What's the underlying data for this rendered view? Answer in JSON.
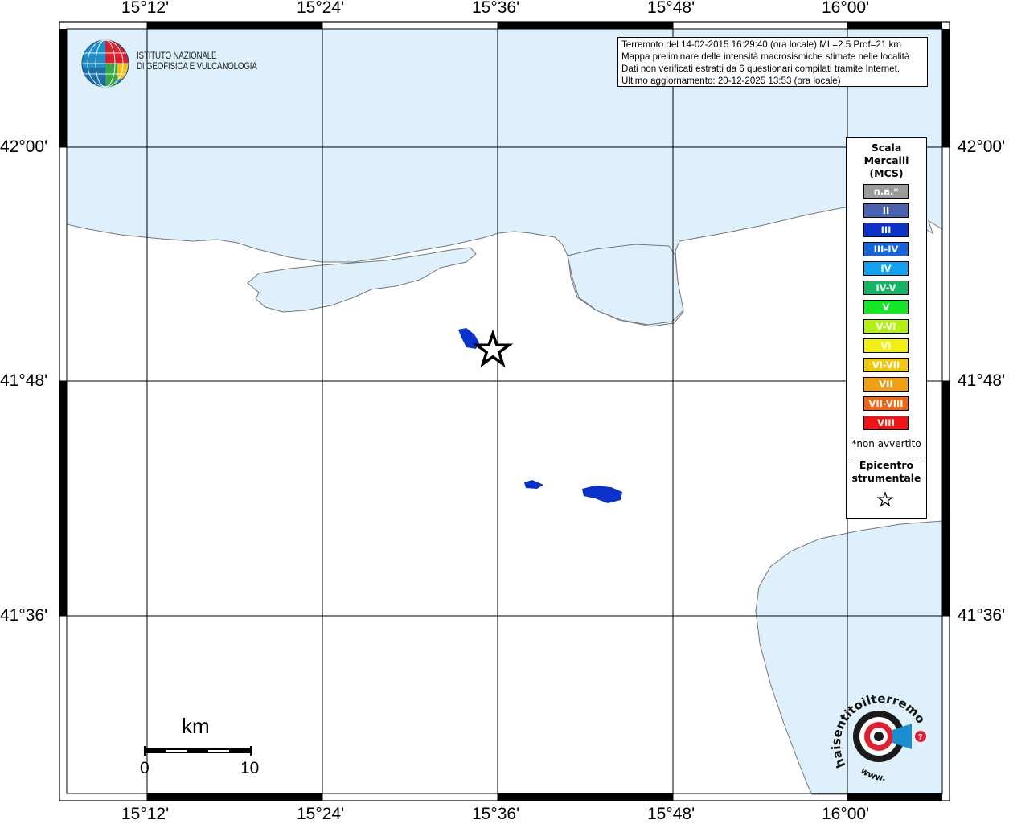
{
  "header": {
    "line1": "Terremoto del 14-02-2015 16:29:40 (ora locale) ML=2.5 Prof=21 km",
    "line2": "Mappa preliminare delle intensità macrosismiche stimate nelle località",
    "line3": "Dati non verificati estratti da 6 questionari compilati tramite Internet.",
    "line4": "Ultimo aggiornamento: 20-12-2025 13:53 (ora locale)"
  },
  "institute": {
    "line1": "ISTITUTO NAZIONALE",
    "line2": "DI GEOFISICA E VULCANOLOGIA"
  },
  "axes": {
    "top": [
      "15°12'",
      "15°24'",
      "15°36'",
      "15°48'",
      "16°00'"
    ],
    "bottom": [
      "15°12'",
      "15°24'",
      "15°36'",
      "15°48'",
      "16°00'"
    ],
    "left": [
      "42°00'",
      "41°48'",
      "41°36'"
    ],
    "right": [
      "42°00'",
      "41°48'",
      "41°36'"
    ]
  },
  "legend": {
    "title": [
      "Scala",
      "Mercalli",
      "(MCS)"
    ],
    "items": [
      {
        "label": "n.a.*",
        "color": "#9b9b9b"
      },
      {
        "label": "II",
        "color": "#4a64b4"
      },
      {
        "label": "III",
        "color": "#0a32c8"
      },
      {
        "label": "III-IV",
        "color": "#1464dc"
      },
      {
        "label": "IV",
        "color": "#14a0f0"
      },
      {
        "label": "IV-V",
        "color": "#14b464"
      },
      {
        "label": "V",
        "color": "#14e628"
      },
      {
        "label": "V-VI",
        "color": "#b4f014"
      },
      {
        "label": "VI",
        "color": "#f0f014"
      },
      {
        "label": "VI-VII",
        "color": "#f0c814"
      },
      {
        "label": "VII",
        "color": "#f0a014"
      },
      {
        "label": "VII-VIII",
        "color": "#f06414"
      },
      {
        "label": "VIII",
        "color": "#f01414"
      }
    ],
    "note": "*non avvertito",
    "epicenter": [
      "Epicentro",
      "strumentale"
    ]
  },
  "scalebar": {
    "unit": "km",
    "start": "0",
    "end": "10"
  },
  "watermark": {
    "text": "haisentitoilterremoto.it",
    "url_text": "www."
  },
  "colors": {
    "sea": "#ddf0fc",
    "land": "#ffffff",
    "felt_locality": "#0a32c8",
    "frame": "#000000"
  }
}
